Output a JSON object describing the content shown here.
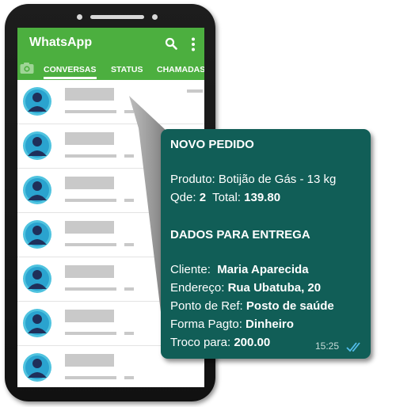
{
  "app": {
    "title": "WhatsApp",
    "tabs": [
      "CONVERSAS",
      "STATUS",
      "CHAMADAS"
    ],
    "active_tab": "CONVERSAS"
  },
  "chat_rows": 7,
  "order": {
    "heading": "NOVO PEDIDO",
    "product_label": "Produto:",
    "product_value": "Botijão de Gás - 13 kg",
    "qty_label": "Qde:",
    "qty_value": "2",
    "total_label": "Total:",
    "total_value": "139.80",
    "delivery_heading": "DADOS PARA ENTREGA",
    "client_label": "Cliente:",
    "client_value": "Maria Aparecida",
    "address_label": "Endereço:",
    "address_value": "Rua Ubatuba, 20",
    "ref_label": "Ponto de Ref:",
    "ref_value": "Posto de saúde",
    "payment_label": "Forma Pagto:",
    "payment_value": "Dinheiro",
    "change_label": "Troco para:",
    "change_value": "200.00",
    "time": "15:25"
  },
  "colors": {
    "appbar": "#4caf3f",
    "bubble": "#115e57",
    "ticks": "#53bdeb",
    "placeholder": "#c9c9c9"
  },
  "icons": [
    "camera-icon",
    "search-icon",
    "more-vert-icon",
    "double-check-icon",
    "avatar-icon"
  ]
}
